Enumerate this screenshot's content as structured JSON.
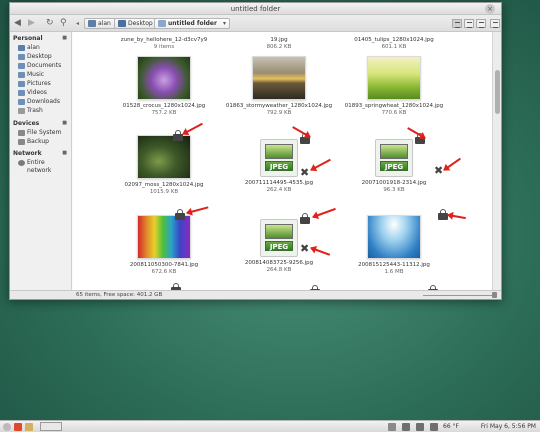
{
  "window": {
    "title": "untitled folder",
    "close_glyph": "×"
  },
  "toolbar": {
    "breadcrumbs": [
      {
        "label": "alan"
      },
      {
        "label": "Desktop"
      },
      {
        "label": "untitled folder"
      }
    ],
    "dropdown_glyph": "▾"
  },
  "sidebar": {
    "sections": [
      {
        "title": "Personal",
        "items": [
          "alan",
          "Desktop",
          "Documents",
          "Music",
          "Pictures",
          "Videos",
          "Downloads",
          "Trash"
        ]
      },
      {
        "title": "Devices",
        "items": [
          "File System",
          "Backup"
        ]
      },
      {
        "title": "Network",
        "items": [
          "Entire network"
        ]
      }
    ]
  },
  "files": {
    "row0": [
      {
        "name": "zune_by_hellohere_12-d3cv7y9",
        "size": "9 items"
      },
      {
        "name": "19.jpg",
        "size": "806.2 KB"
      },
      {
        "name": "01405_tulips_1280x1024.jpg",
        "size": "601.1 KB"
      }
    ],
    "row1": [
      {
        "name": "01528_crocus_1280x1024.jpg",
        "size": "757.2 KB"
      },
      {
        "name": "01863_stormyweather_1280x1024.jpg",
        "size": "792.9 KB"
      },
      {
        "name": "01893_springwheat_1280x1024.jpg",
        "size": "770.6 KB"
      }
    ],
    "row2": [
      {
        "name": "02097_moss_1280x1024.jpg",
        "size": "1015.9 KB"
      },
      {
        "name": "200711114495-4535.jpg",
        "size": "262.4 KB"
      },
      {
        "name": "20071001918-2314.jpg",
        "size": "96.3 KB"
      }
    ],
    "row3": [
      {
        "name": "200811050300-7841.jpg",
        "size": "672.6 KB"
      },
      {
        "name": "200814083725-9256.jpg",
        "size": "264.8 KB"
      },
      {
        "name": "200815125443-11312.jpg",
        "size": "1.6 MB"
      }
    ],
    "jpeg_label": "JPEG"
  },
  "status": {
    "text": "65 items, Free space: 401.2 GB"
  },
  "taskbar": {
    "tray_text": "66 °F",
    "clock": "Fri May 6, 5:56 PM"
  }
}
